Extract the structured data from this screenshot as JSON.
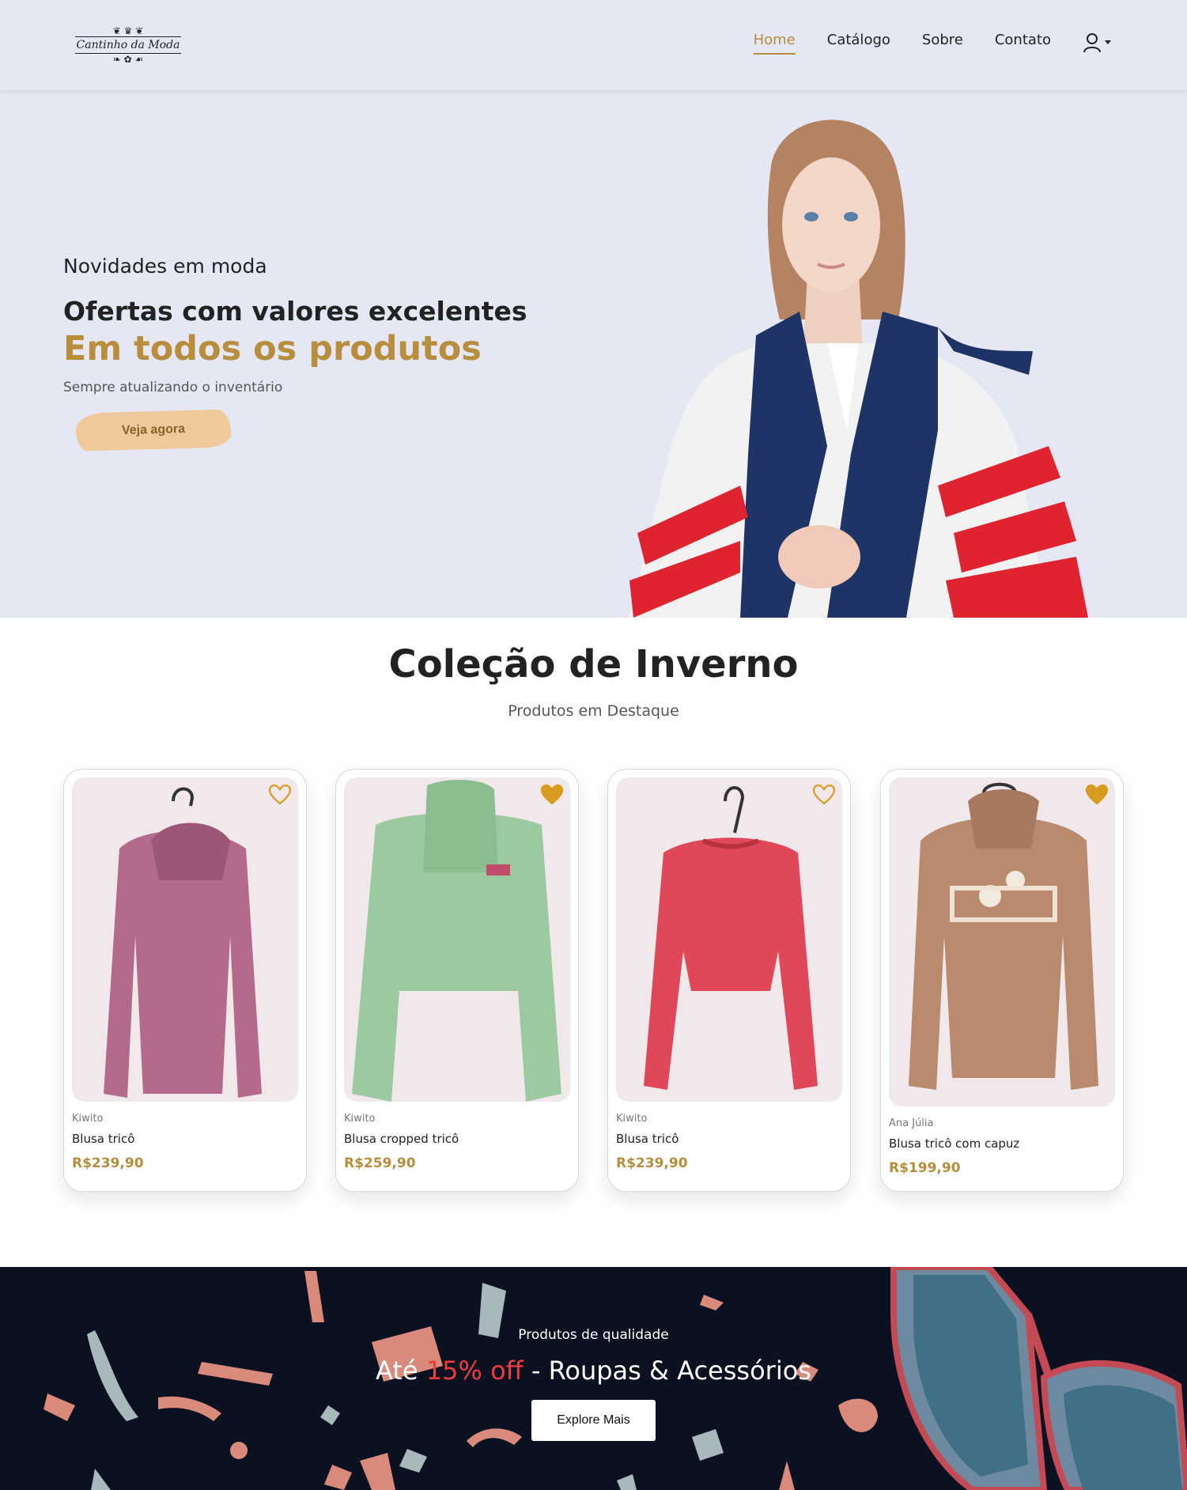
{
  "header": {
    "logo_text": "Cantinho da Moda",
    "nav": [
      {
        "label": "Home",
        "active": true
      },
      {
        "label": "Catálogo",
        "active": false
      },
      {
        "label": "Sobre",
        "active": false
      },
      {
        "label": "Contato",
        "active": false
      }
    ],
    "user_icon": "user-icon"
  },
  "hero": {
    "eyebrow": "Novidades em moda",
    "title": "Ofertas com valores excelentes",
    "subtitle": "Em todos os produtos",
    "note": "Sempre atualizando o inventário",
    "cta": "Veja agora"
  },
  "collection": {
    "title": "Coleção de Inverno",
    "subtitle": "Produtos em Destaque",
    "products": [
      {
        "brand": "Kiwito",
        "name": "Blusa tricô",
        "price": "R$239,90",
        "favorited": false,
        "color": "#b46a8a"
      },
      {
        "brand": "Kiwito",
        "name": "Blusa cropped tricô",
        "price": "R$259,90",
        "favorited": true,
        "color": "#9ccaa0"
      },
      {
        "brand": "Kiwito",
        "name": "Blusa tricô",
        "price": "R$239,90",
        "favorited": false,
        "color": "#e04758"
      },
      {
        "brand": "Ana Júlia",
        "name": "Blusa tricô com capuz",
        "price": "R$199,90",
        "favorited": true,
        "color": "#b98a6e"
      }
    ]
  },
  "promo": {
    "eyebrow": "Produtos de qualidade",
    "title_prefix": "Até ",
    "title_highlight": "15% off",
    "title_suffix": " - Roupas & Acessórios",
    "cta": "Explore Mais"
  },
  "colors": {
    "accent": "#b88d3b",
    "header_bg": "#e5e8f4",
    "promo_bg": "#0b1120",
    "highlight": "#f03c3c"
  }
}
